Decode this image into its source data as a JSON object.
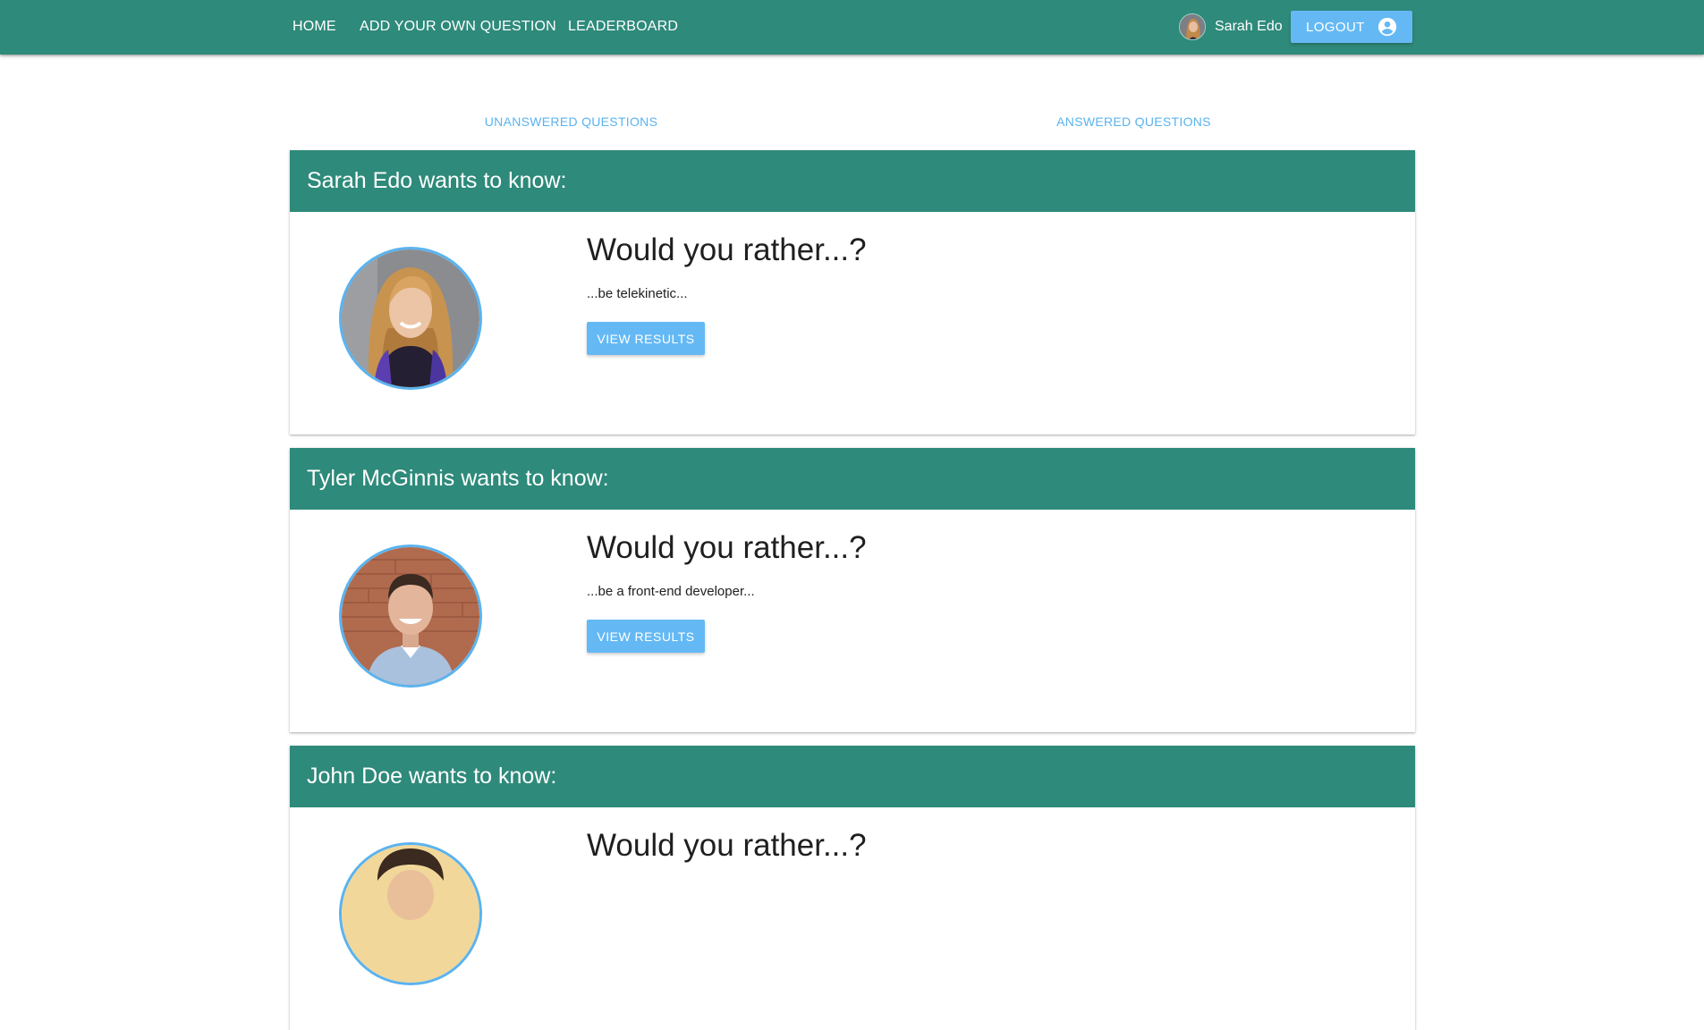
{
  "nav": {
    "home": "HOME",
    "add_question": "ADD YOUR OWN QUESTION",
    "leaderboard": "LEADERBOARD"
  },
  "user": {
    "name": "Sarah Edo",
    "logout_label": "LOGOUT",
    "logout_icon": "account-circle-icon"
  },
  "tabs": {
    "unanswered": "UNANSWERED QUESTIONS",
    "answered": "ANSWERED QUESTIONS"
  },
  "questions": [
    {
      "header": "Sarah Edo wants to know:",
      "title": "Would you rather...?",
      "option": "...be telekinetic...",
      "button": "VIEW RESULTS"
    },
    {
      "header": "Tyler McGinnis wants to know:",
      "title": "Would you rather...?",
      "option": "...be a front-end developer...",
      "button": "VIEW RESULTS"
    },
    {
      "header": "John Doe wants to know:",
      "title": "Would you rather...?"
    }
  ],
  "colors": {
    "primary": "#2e8a7a",
    "accent": "#64b9f4",
    "tab_text": "#5ab3ef"
  }
}
